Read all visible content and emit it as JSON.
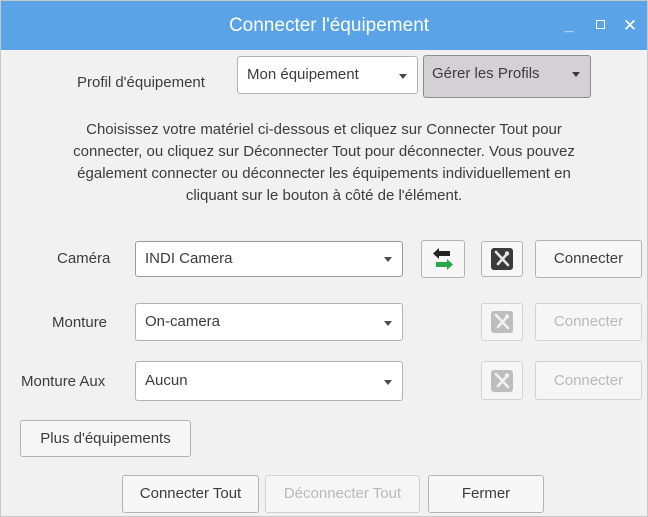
{
  "window": {
    "title": "Connecter l'équipement",
    "minimize_glyph": "_",
    "close_glyph": "✕"
  },
  "profile": {
    "label": "Profil d'équipement",
    "selected": "Mon équipement",
    "manage_label": "Gérer les Profils"
  },
  "description": [
    "Choisissez votre matériel ci-dessous et cliquez sur Connecter Tout pour",
    "connecter, ou cliquez sur Déconnecter Tout pour déconnecter. Vous pouvez",
    "également connecter ou déconnecter les équipements individuellement en",
    "cliquant sur le bouton à côté de l'élément."
  ],
  "devices": [
    {
      "label": "Caméra",
      "selected": "INDI Camera",
      "connect_label": "Connecter",
      "enabled": true,
      "has_swap": true,
      "icons": [
        "swap-icon",
        "tools-icon"
      ]
    },
    {
      "label": "Monture",
      "selected": "On-camera",
      "connect_label": "Connecter",
      "enabled": false,
      "has_swap": false,
      "icons": [
        "tools-icon"
      ]
    },
    {
      "label": "Monture Aux",
      "selected": "Aucun",
      "connect_label": "Connecter",
      "enabled": false,
      "has_swap": false,
      "icons": [
        "tools-icon"
      ]
    }
  ],
  "more_label": "Plus d'équipements",
  "footer": {
    "connect_all": "Connecter Tout",
    "disconnect_all": "Déconnecter Tout",
    "close": "Fermer"
  },
  "colors": {
    "titlebar": "#5aa3e6",
    "swap_arrow_green": "#2aa84a",
    "swap_arrow_dark": "#222222"
  }
}
